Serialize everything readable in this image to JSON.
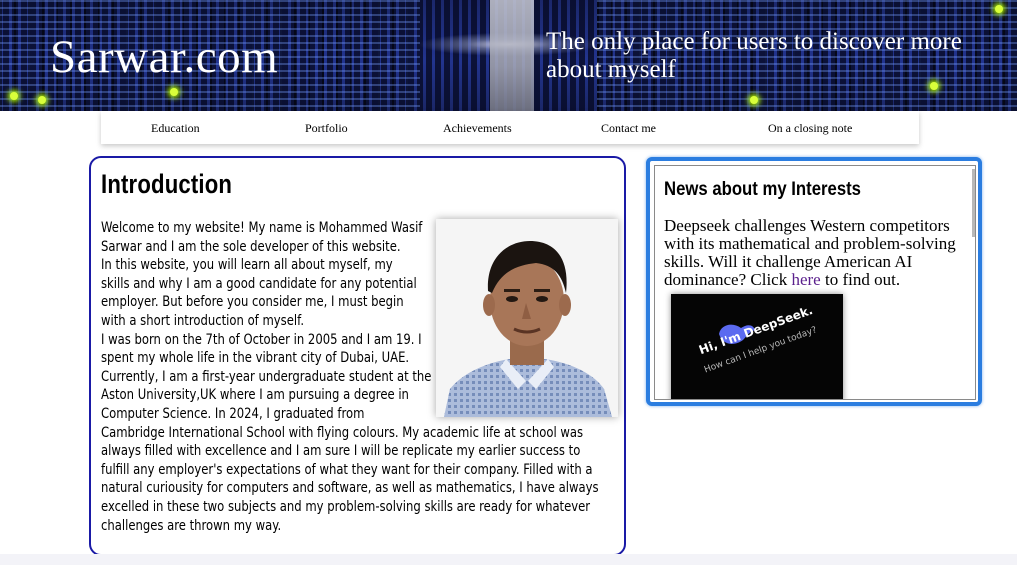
{
  "header": {
    "site_title": "Sarwar.com",
    "tagline": "The only place for users to discover more about myself"
  },
  "nav": {
    "items": [
      {
        "label": "Education"
      },
      {
        "label": "Portfolio"
      },
      {
        "label": "Achievements"
      },
      {
        "label": "Contact me"
      },
      {
        "label": "On a closing note"
      }
    ]
  },
  "intro": {
    "heading": "Introduction",
    "lines": [
      "Welcome to my website! My name is Mohammed Wasif",
      "Sarwar and I am the sole developer of this website.",
      "In this website, you will learn all about myself, my",
      "skills and why I am a good candidate for any potential",
      "employer. But before you consider me, I must begin",
      "with a short introduction of myself.",
      "I was born on the 7th of October in 2005 and I am 19. I",
      "spent my whole life in the vibrant city of Dubai, UAE.",
      "Currently, I am a first-year undergraduate student at the",
      "Aston University,UK where I am pursuing a degree in",
      "Computer Science. In 2024, I graduated from",
      "Cambridge International School with flying colours. My academic life at school was",
      "always filled with excellence and I am sure I will be replicate my earlier success to",
      "fulfill any employer's expectations of what they want for their company. Filled with a",
      "natural curiousity for computers and software, as well as mathematics, I have always",
      "excelled in these two subjects and my problem-solving skills are ready for whatever",
      "challenges are thrown my way."
    ]
  },
  "news": {
    "heading": "News about my Interests",
    "text_before": "Deepseek challenges Western competitors with its mathematical and problem-solving skills. Will it challenge American AI dominance? Click ",
    "link_text": "here",
    "text_after": " to find out.",
    "image_title": "Hi, I'm DeepSeek.",
    "image_subtitle": "How can I help you today?"
  },
  "colors": {
    "intro_border": "#1a1aa6",
    "news_border": "#2b7de0",
    "link": "#5a1f8c"
  }
}
